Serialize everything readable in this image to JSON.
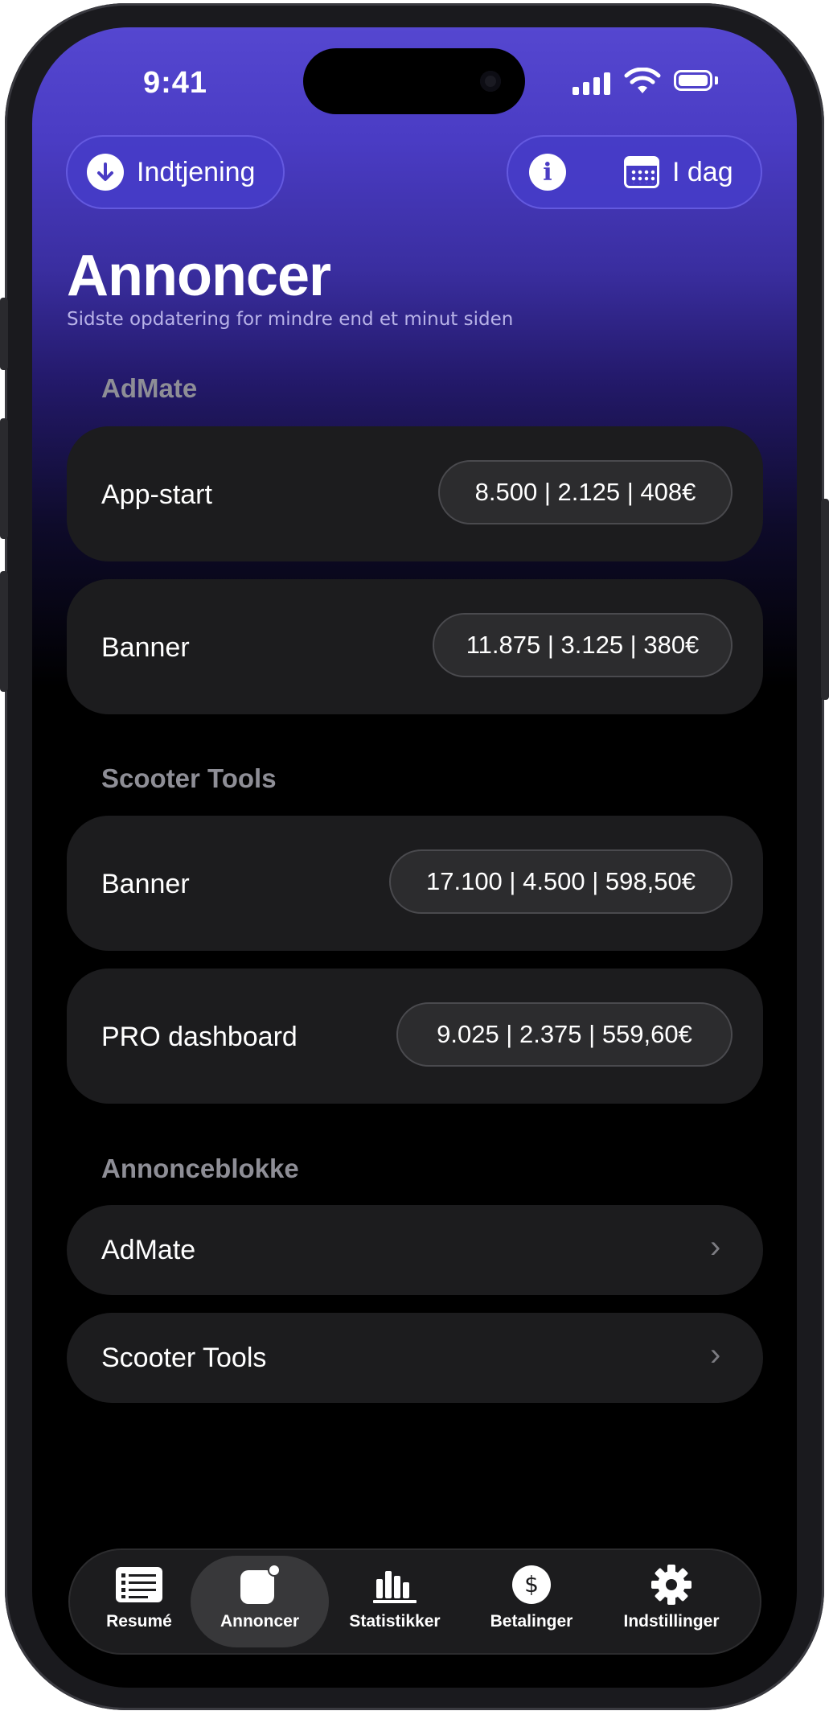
{
  "status_bar": {
    "time": "9:41"
  },
  "header": {
    "earnings_label": "Indtjening",
    "date_label": "I dag",
    "title": "Annoncer",
    "subtitle": "Sidste opdatering for mindre end et minut siden"
  },
  "sections": [
    {
      "title": "AdMate",
      "cards": [
        {
          "label": "App-start",
          "stats": "8.500 | 2.125 | 408€"
        },
        {
          "label": "Banner",
          "stats": "11.875 | 3.125 | 380€"
        }
      ]
    },
    {
      "title": "Scooter Tools",
      "cards": [
        {
          "label": "Banner",
          "stats": "17.100 | 4.500 | 598,50€"
        },
        {
          "label": "PRO dashboard",
          "stats": "9.025 | 2.375 | 559,60€"
        }
      ]
    }
  ],
  "ad_blocks": {
    "title": "Annonceblokke",
    "items": [
      {
        "label": "AdMate"
      },
      {
        "label": "Scooter Tools"
      }
    ]
  },
  "tabbar": {
    "items": [
      {
        "label": "Resumé",
        "icon": "list-icon"
      },
      {
        "label": "Annoncer",
        "icon": "ads-icon",
        "active": true
      },
      {
        "label": "Statistikker",
        "icon": "bar-chart-icon"
      },
      {
        "label": "Betalinger",
        "icon": "dollar-icon"
      },
      {
        "label": "Indstillinger",
        "icon": "gear-icon"
      }
    ]
  },
  "colors": {
    "accent": "#4a3cc4",
    "card": "#1c1c1e",
    "background": "#000000"
  }
}
